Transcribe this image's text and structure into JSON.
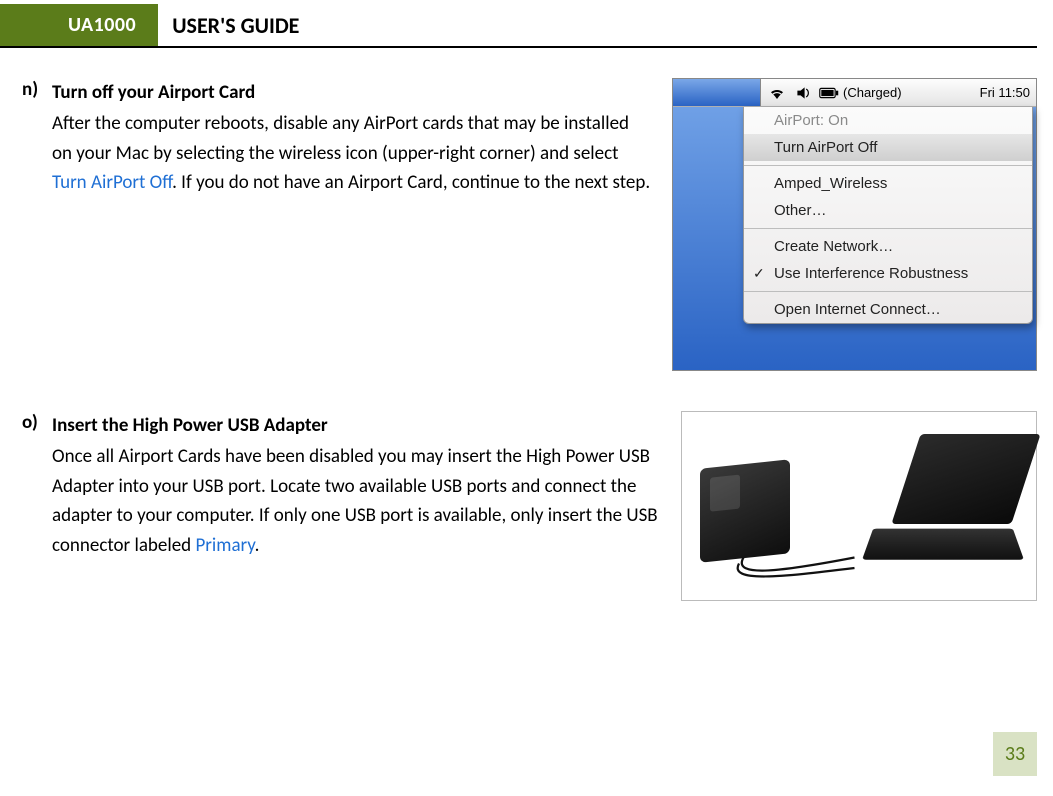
{
  "header": {
    "badge": "UA1000",
    "title": "USER'S GUIDE"
  },
  "steps": {
    "n": {
      "label": "n)",
      "title": "Turn off your Airport Card",
      "body_before_link": "After the computer reboots, disable any AirPort cards that may be installed on your Mac by selecting the wireless icon (upper-right corner) and select ",
      "link_text": "Turn AirPort Off",
      "body_after_link": ". If you do not have an Airport Card, continue to the next step."
    },
    "o": {
      "label": "o)",
      "title": "Insert the High Power USB Adapter",
      "body_before_link": "Once all Airport Cards have been disabled you may insert the High Power USB Adapter into your USB port. Locate two available USB ports and connect the adapter to your computer. If only one USB port is available, only insert the USB connector labeled ",
      "link_text": "Primary",
      "body_after_link": "."
    }
  },
  "mac_menu": {
    "charged_label": "(Charged)",
    "clock": "Fri 11:50",
    "items": {
      "airport_on": "AirPort: On",
      "turn_off": "Turn AirPort Off",
      "network1": "Amped_Wireless",
      "other": "Other…",
      "create": "Create Network…",
      "robust": "Use Interference Robustness",
      "open_ic": "Open Internet Connect…"
    }
  },
  "page_number": "33"
}
